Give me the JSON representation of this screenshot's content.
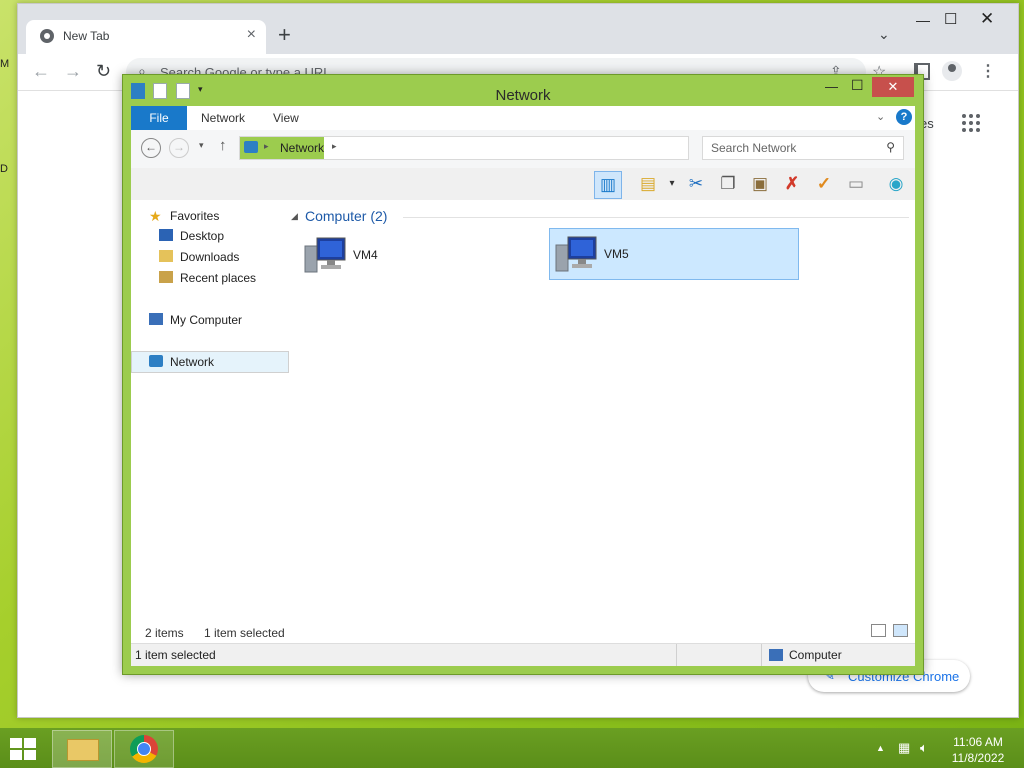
{
  "desktop": {
    "edge_marks": [
      "M",
      "D"
    ]
  },
  "chrome": {
    "tab_title": "New Tab",
    "omnibox_placeholder": "Search Google or type a URL",
    "ntp_partial_link": "es",
    "customize_label": "Customize Chrome"
  },
  "explorer": {
    "title": "Network",
    "ribbon_tabs": [
      "File",
      "Network",
      "View"
    ],
    "breadcrumb": "Network",
    "search_placeholder": "Search Network",
    "nav": {
      "favorites": "Favorites",
      "desktop": "Desktop",
      "downloads": "Downloads",
      "recent": "Recent places",
      "my_computer": "My Computer",
      "network": "Network"
    },
    "group_label": "Computer (2)",
    "items": [
      {
        "name": "VM4",
        "selected": false
      },
      {
        "name": "VM5",
        "selected": true
      }
    ],
    "status_inner": {
      "count": "2 items",
      "selection": "1 item selected"
    },
    "status_outer": {
      "selection": "1 item selected",
      "zone": "Computer"
    }
  },
  "taskbar": {
    "time": "11:06 AM",
    "date": "11/8/2022"
  },
  "colors": {
    "accent_green": "#9ccc4e",
    "file_tab_blue": "#1979ca",
    "close_red": "#c7504c"
  }
}
